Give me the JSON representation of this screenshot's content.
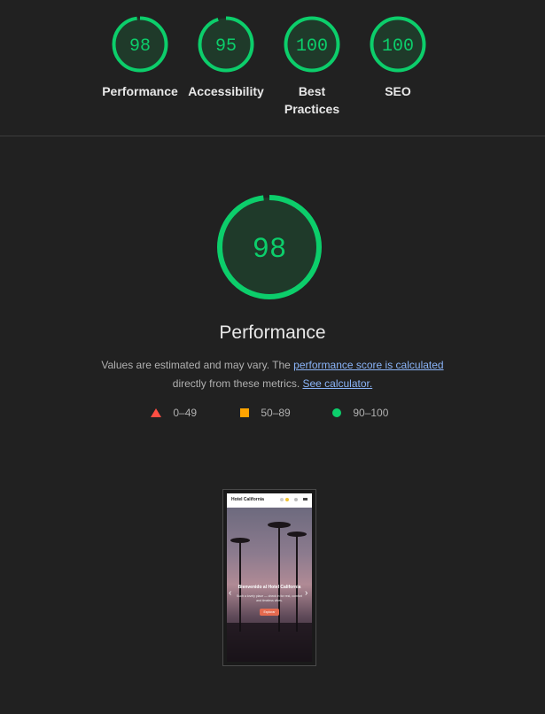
{
  "gauges": [
    {
      "score": "98",
      "label": "Performance",
      "value": 98
    },
    {
      "score": "95",
      "label": "Accessibility",
      "value": 95
    },
    {
      "score": "100",
      "label": "Best Practices",
      "value": 100
    },
    {
      "score": "100",
      "label": "SEO",
      "value": 100
    }
  ],
  "main": {
    "score": "98",
    "value": 98,
    "title": "Performance",
    "desc_prefix": "Values are estimated and may vary. The ",
    "desc_link": "performance score is calculated",
    "desc_mid": " directly from these metrics. ",
    "desc_link2": "See calculator."
  },
  "legend": {
    "fail": "0–49",
    "average": "50–89",
    "pass": "90–100",
    "fail_icon": "triangle-icon",
    "average_icon": "square-icon",
    "pass_icon": "circle-icon"
  },
  "screenshot": {
    "brand": "Hotel California",
    "hero_title": "Bienvenido al Hotel California",
    "hero_sub": "Such a lovely place — check in for rest, comfort and timeless vibes.",
    "hero_button": "Explorar"
  },
  "colors": {
    "pass": "#0cce6b",
    "average": "#ffa400",
    "fail": "#ff4e42",
    "background": "#212121",
    "link": "#8ab4f8"
  }
}
